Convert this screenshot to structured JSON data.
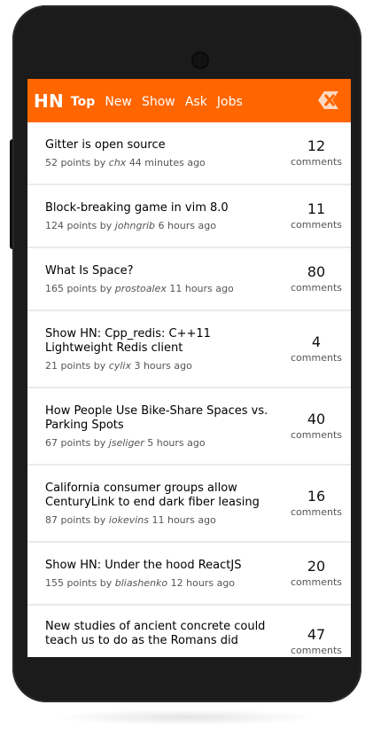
{
  "header": {
    "brand": "HN",
    "nav": [
      {
        "label": "Top",
        "active": true
      },
      {
        "label": "New",
        "active": false
      },
      {
        "label": "Show",
        "active": false
      },
      {
        "label": "Ask",
        "active": false
      },
      {
        "label": "Jobs",
        "active": false
      }
    ],
    "logo_icon": "hn-logo-icon",
    "bg_color": "#ff6600"
  },
  "stories": [
    {
      "title": "Gitter is open source",
      "points": "52 points by",
      "user": "chx",
      "time": "44 minutes ago",
      "comments": "12",
      "comments_label": "comments"
    },
    {
      "title": "Block-breaking game in vim 8.0",
      "points": "124 points by",
      "user": "johngrib",
      "time": "6 hours ago",
      "comments": "11",
      "comments_label": "comments"
    },
    {
      "title": "What Is Space?",
      "points": "165 points by",
      "user": "prostoalex",
      "time": "11 hours ago",
      "comments": "80",
      "comments_label": "comments"
    },
    {
      "title": "Show HN: Cpp_redis: C++11 Lightweight Redis client",
      "points": "21 points by",
      "user": "cylix",
      "time": "3 hours ago",
      "comments": "4",
      "comments_label": "comments"
    },
    {
      "title": "How People Use Bike-Share Spaces vs. Parking Spots",
      "points": "67 points by",
      "user": "jseliger",
      "time": "5 hours ago",
      "comments": "40",
      "comments_label": "comments"
    },
    {
      "title": "California consumer groups allow CenturyLink to end dark fiber leasing",
      "points": "87 points by",
      "user": "iokevins",
      "time": "11 hours ago",
      "comments": "16",
      "comments_label": "comments"
    },
    {
      "title": "Show HN: Under the hood ReactJS",
      "points": "155 points by",
      "user": "bliashenko",
      "time": "12 hours ago",
      "comments": "20",
      "comments_label": "comments"
    },
    {
      "title": "New studies of ancient concrete could teach us to do as the Romans did",
      "points": "",
      "user": "",
      "time": "",
      "comments": "47",
      "comments_label": "comments"
    }
  ]
}
